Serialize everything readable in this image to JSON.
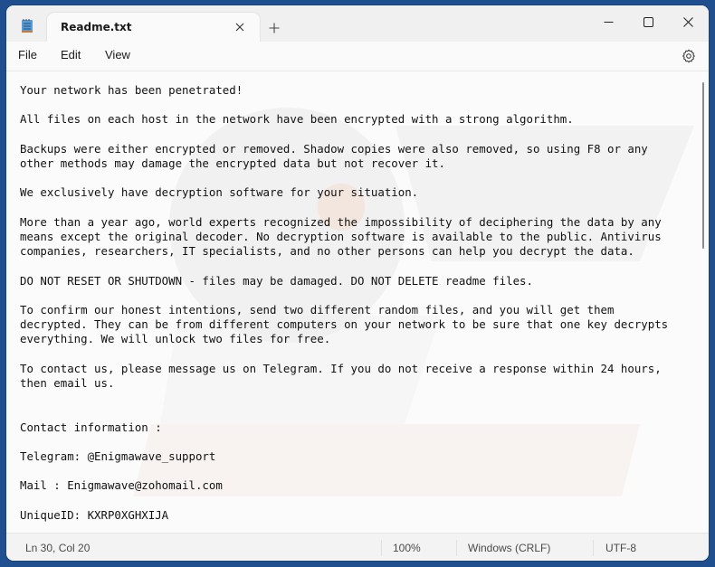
{
  "window": {
    "tab_title": "Readme.txt",
    "icons": {
      "app": "notepad-icon",
      "tab_close": "close-icon",
      "new_tab": "plus-icon",
      "minimize": "minimize-icon",
      "maximize": "maximize-icon",
      "close": "close-icon",
      "settings": "gear-icon"
    }
  },
  "menu": {
    "items": [
      {
        "label": "File"
      },
      {
        "label": "Edit"
      },
      {
        "label": "View"
      }
    ]
  },
  "document": {
    "lines": [
      "Your network has been penetrated!",
      "",
      "All files on each host in the network have been encrypted with a strong algorithm.",
      "",
      "Backups were either encrypted or removed. Shadow copies were also removed, so using F8 or any",
      "other methods may damage the encrypted data but not recover it.",
      "",
      "We exclusively have decryption software for your situation.",
      "",
      "More than a year ago, world experts recognized the impossibility of deciphering the data by any",
      "means except the original decoder. No decryption software is available to the public. Antivirus",
      "companies, researchers, IT specialists, and no other persons can help you decrypt the data.",
      "",
      "DO NOT RESET OR SHUTDOWN - files may be damaged. DO NOT DELETE readme files.",
      "",
      "To confirm our honest intentions, send two different random files, and you will get them",
      "decrypted. They can be from different computers on your network to be sure that one key decrypts",
      "everything. We will unlock two files for free.",
      "",
      "To contact us, please message us on Telegram. If you do not receive a response within 24 hours,",
      "then email us.",
      "",
      "",
      "Contact information :",
      "",
      "Telegram: @Enigmawave_support",
      "",
      "Mail : Enigmawave@zohomail.com",
      "",
      "UniqueID: KXRP0XGHXIJA"
    ]
  },
  "status": {
    "position": "Ln 30, Col 20",
    "zoom": "100%",
    "line_ending": "Windows (CRLF)",
    "encoding": "UTF-8"
  }
}
